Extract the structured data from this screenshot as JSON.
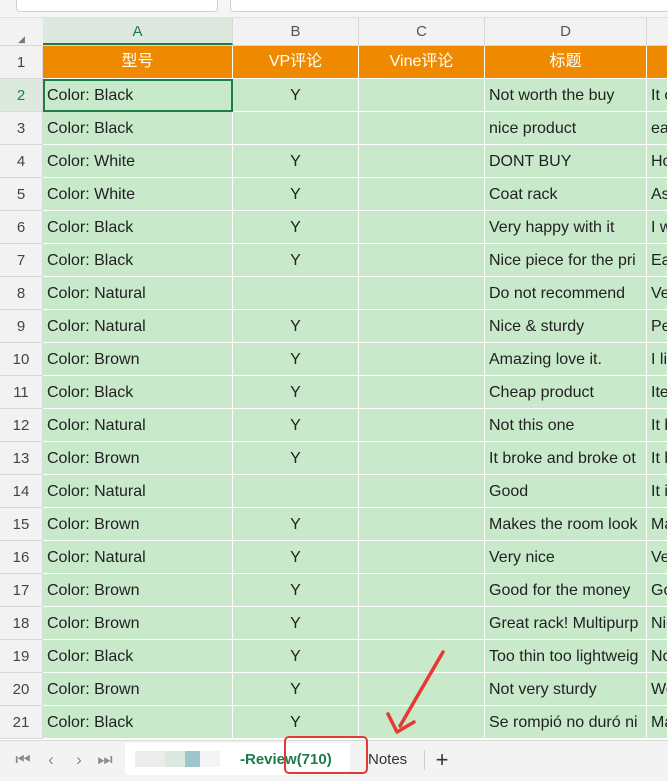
{
  "columns": [
    {
      "letter": "A",
      "header": "型号"
    },
    {
      "letter": "B",
      "header": "VP评论"
    },
    {
      "letter": "C",
      "header": "Vine评论"
    },
    {
      "letter": "D",
      "header": "标题"
    },
    {
      "letter": "",
      "header": ""
    }
  ],
  "header_row_number": "1",
  "rows": [
    {
      "num": "2",
      "a": "Color: Black",
      "b": "Y",
      "c": "",
      "d": "Not worth the buy",
      "e": "It c"
    },
    {
      "num": "3",
      "a": "Color: Black",
      "b": "",
      "c": "",
      "d": "nice product",
      "e": "eas"
    },
    {
      "num": "4",
      "a": "Color: White",
      "b": "Y",
      "c": "",
      "d": "DONT BUY",
      "e": "Ho"
    },
    {
      "num": "5",
      "a": "Color: White",
      "b": "Y",
      "c": "",
      "d": "Coat rack",
      "e": "As"
    },
    {
      "num": "6",
      "a": "Color: Black",
      "b": "Y",
      "c": "",
      "d": "Very happy with it",
      "e": "I w"
    },
    {
      "num": "7",
      "a": "Color: Black",
      "b": "Y",
      "c": "",
      "d": "Nice piece for the pri",
      "e": "Ea"
    },
    {
      "num": "8",
      "a": "Color: Natural",
      "b": "",
      "c": "",
      "d": "Do not recommend",
      "e": "Ve"
    },
    {
      "num": "9",
      "a": "Color: Natural",
      "b": "Y",
      "c": "",
      "d": "Nice & sturdy",
      "e": "Pe"
    },
    {
      "num": "10",
      "a": "Color: Brown",
      "b": "Y",
      "c": "",
      "d": "Amazing love it.",
      "e": "I li"
    },
    {
      "num": "11",
      "a": "Color: Black",
      "b": "Y",
      "c": "",
      "d": "Cheap product",
      "e": "Ite"
    },
    {
      "num": "12",
      "a": "Color: Natural",
      "b": "Y",
      "c": "",
      "d": "Not this one",
      "e": "It b"
    },
    {
      "num": "13",
      "a": "Color: Brown",
      "b": "Y",
      "c": "",
      "d": "It broke and broke ot",
      "e": "It b"
    },
    {
      "num": "14",
      "a": "Color: Natural",
      "b": "",
      "c": "",
      "d": "Good",
      "e": "It i"
    },
    {
      "num": "15",
      "a": "Color: Brown",
      "b": "Y",
      "c": "",
      "d": "Makes the room look",
      "e": "Ma"
    },
    {
      "num": "16",
      "a": "Color: Natural",
      "b": "Y",
      "c": "",
      "d": "Very nice",
      "e": "Ve"
    },
    {
      "num": "17",
      "a": "Color: Brown",
      "b": "Y",
      "c": "",
      "d": "Good for the money",
      "e": "Go"
    },
    {
      "num": "18",
      "a": "Color: Brown",
      "b": "Y",
      "c": "",
      "d": "Great rack! Multipurp",
      "e": "Nic"
    },
    {
      "num": "19",
      "a": "Color: Black",
      "b": "Y",
      "c": "",
      "d": "Too thin too lightweig",
      "e": "No"
    },
    {
      "num": "20",
      "a": "Color: Brown",
      "b": "Y",
      "c": "",
      "d": "Not very sturdy",
      "e": "We"
    },
    {
      "num": "21",
      "a": "Color: Black",
      "b": "Y",
      "c": "",
      "d": "Se rompió no duró ni",
      "e": "Ma"
    }
  ],
  "sheet_tabs": {
    "active_label": "-Review(710)",
    "notes_label": "Notes",
    "add_label": "+"
  },
  "nav_icons": [
    "first-sheet-icon",
    "prev-sheet-icon",
    "next-sheet-icon",
    "last-sheet-icon"
  ],
  "colors": {
    "header_fill": "#ef8a00",
    "cell_fill": "#c9e9cb",
    "active_accent": "#1e7b4b",
    "annotation_red": "#e53935"
  }
}
